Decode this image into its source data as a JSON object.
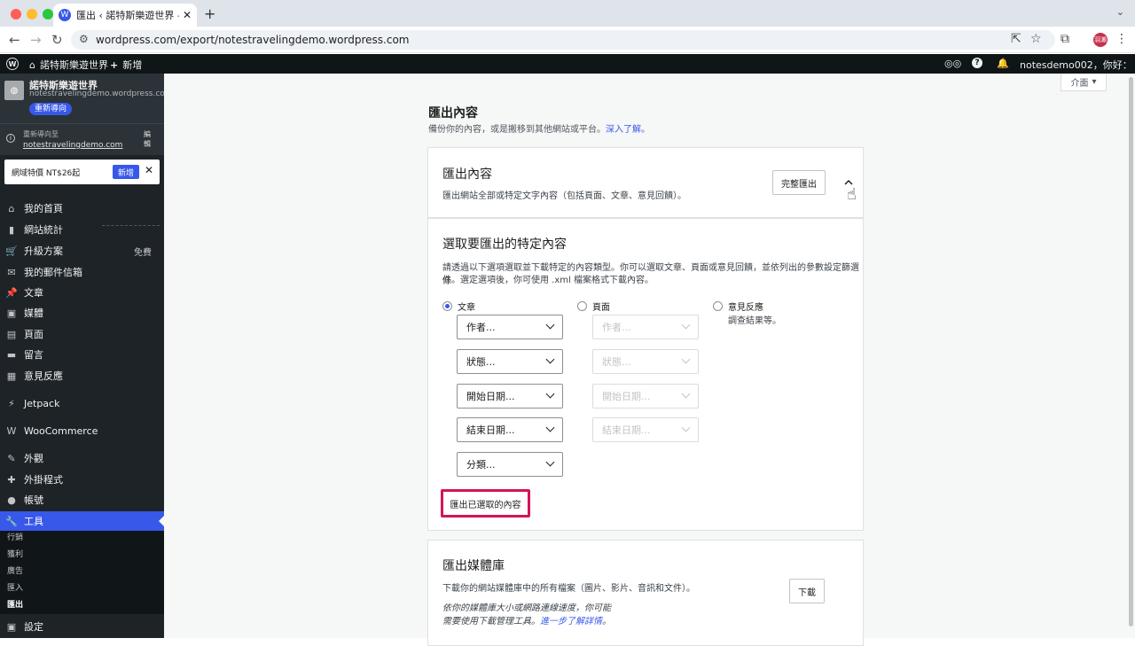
{
  "browser": {
    "tab_title": "匯出 ‹ 諾特斯樂遊世界 — WordPress.com",
    "tab_close": "✕",
    "new_tab": "+",
    "url": "wordpress.com/export/notestravelingdemo.wordpress.com",
    "profile_label": "羽瀨"
  },
  "adminbar": {
    "site_name": "諾特斯樂遊世界",
    "new_label": "新增",
    "greeting": "notesdemo002，你好：",
    "logo": "W"
  },
  "sidebar": {
    "site_name": "諾特斯樂遊世界",
    "site_domain": "notestravelingdemo.wordpress.com",
    "redirect_button": "重新導向",
    "redirect_label": "重新導向至",
    "redirect_domain": "notestravelingdemo.com",
    "redirect_edit": "編輯",
    "promo_text": "網域特價 NT$26起",
    "promo_button": "新增",
    "items": [
      {
        "label": "我的首頁",
        "icon": "⌂"
      },
      {
        "label": "網站統計",
        "icon": "▮"
      },
      {
        "label": "升級方案",
        "icon": "🛒",
        "badge": "免費"
      },
      {
        "label": "我的郵件信箱",
        "icon": "✉"
      },
      {
        "label": "文章",
        "icon": "📌"
      },
      {
        "label": "媒體",
        "icon": "▣"
      },
      {
        "label": "頁面",
        "icon": "▤"
      },
      {
        "label": "留言",
        "icon": "▬"
      },
      {
        "label": "意見反應",
        "icon": "▦"
      },
      {
        "label": "Jetpack",
        "icon": "⚡"
      },
      {
        "label": "WooCommerce",
        "icon": "W"
      },
      {
        "label": "外觀",
        "icon": "✎"
      },
      {
        "label": "外掛程式",
        "icon": "✚"
      },
      {
        "label": "帳號",
        "icon": "●"
      },
      {
        "label": "工具",
        "icon": "🔧"
      }
    ],
    "submenu": [
      "行銷",
      "獲利",
      "廣告",
      "匯入",
      "匯出"
    ],
    "settings": "設定"
  },
  "main": {
    "view_button": "介面",
    "title": "匯出內容",
    "subtitle": "備份你的內容，或是搬移到其他網站或平台。",
    "learn_more": "深入了解。",
    "export_card": {
      "title": "匯出內容",
      "desc": "匯出網站全部或特定文字內容（包括頁面、文章、意見回饋）。",
      "button": "完整匯出"
    },
    "specific": {
      "title": "選取要匯出的特定內容",
      "desc1": "請透過以下選項選取並下載特定的內容類型。你可以選取文章、頁面或意見回饋，並依列出的參數設定篩選條",
      "desc2": "件。選定選項後，你可使用 .xml 檔案格式下載內容。",
      "radio_posts": "文章",
      "radio_pages": "頁面",
      "radio_feedback": "意見反應",
      "feedback_desc": "調查結果等。",
      "posts_filters": [
        "作者...",
        "狀態...",
        "開始日期...",
        "結束日期...",
        "分類..."
      ],
      "pages_filters": [
        "作者...",
        "狀態...",
        "開始日期...",
        "結束日期..."
      ],
      "export_selected": "匯出已選取的內容"
    },
    "media_card": {
      "title": "匯出媒體庫",
      "desc": "下載你的網站媒體庫中的所有檔案（圖片、影片、音訊和文件）。",
      "note1": "依你的媒體庫大小或網路連線速度，你可能",
      "note2": "需要使用下載管理工具。",
      "note_link": "進一步了解詳情",
      "note_end": "。",
      "button": "下載"
    }
  },
  "colors": {
    "accent": "#3858e9",
    "highlight": "#d4145a",
    "sidebar": "#1d2327"
  }
}
